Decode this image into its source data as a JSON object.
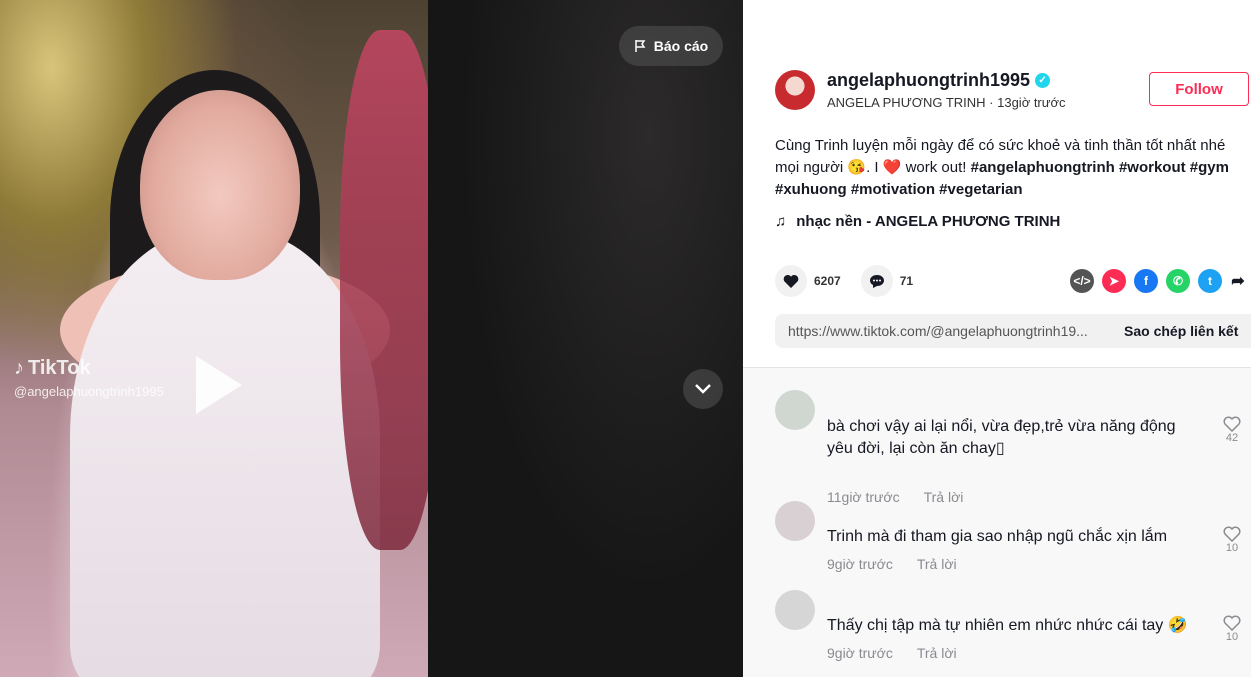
{
  "video": {
    "report_label": "Báo cáo",
    "watermark_brand": "TikTok",
    "watermark_user": "@angelaphuongtrinh1995"
  },
  "author": {
    "username": "angelaphuongtrinh1995",
    "nickname": "ANGELA PHƯƠNG TRINH",
    "time": "13giờ trước",
    "follow_label": "Follow"
  },
  "caption": {
    "text": "Cùng Trinh luyện mỗi ngày để có sức khoẻ và tinh thần tốt nhất nhé mọi người 😘. I ❤️ work out!",
    "hashtags": "#angelaphuongtrinh #workout #gym #xuhuong #motivation #vegetarian"
  },
  "music": {
    "label": "nhạc nền - ANGELA PHƯƠNG TRINH"
  },
  "stats": {
    "likes": "6207",
    "comments": "71"
  },
  "share": {
    "url": "https://www.tiktok.com/@angelaphuongtrinh19...",
    "copy_label": "Sao chép liên kết"
  },
  "comments": [
    {
      "text": "bà chơi vậy ai lại nổi, vừa đẹp,trẻ vừa năng động yêu đời, lại còn ăn chay▯",
      "time": "11giờ trước",
      "reply": "Trả lời",
      "likes": "42"
    },
    {
      "text": "Trinh mà đi tham gia sao nhập ngũ chắc xịn lắm",
      "time": "9giờ trước",
      "reply": "Trả lời",
      "likes": "10"
    },
    {
      "text": "Thấy chị tập mà tự nhiên em nhức nhức cái tay 🤣",
      "time": "9giờ trước",
      "reply": "Trả lời",
      "likes": "10"
    }
  ],
  "colors": {
    "accent": "#fe2c55",
    "verified": "#20d5ec"
  },
  "icons": [
    "flag-icon",
    "chevron-down-icon",
    "music-note-icon",
    "heart-icon",
    "comment-icon",
    "embed-icon",
    "send-icon",
    "facebook-icon",
    "whatsapp-icon",
    "twitter-icon",
    "share-arrow-icon"
  ]
}
